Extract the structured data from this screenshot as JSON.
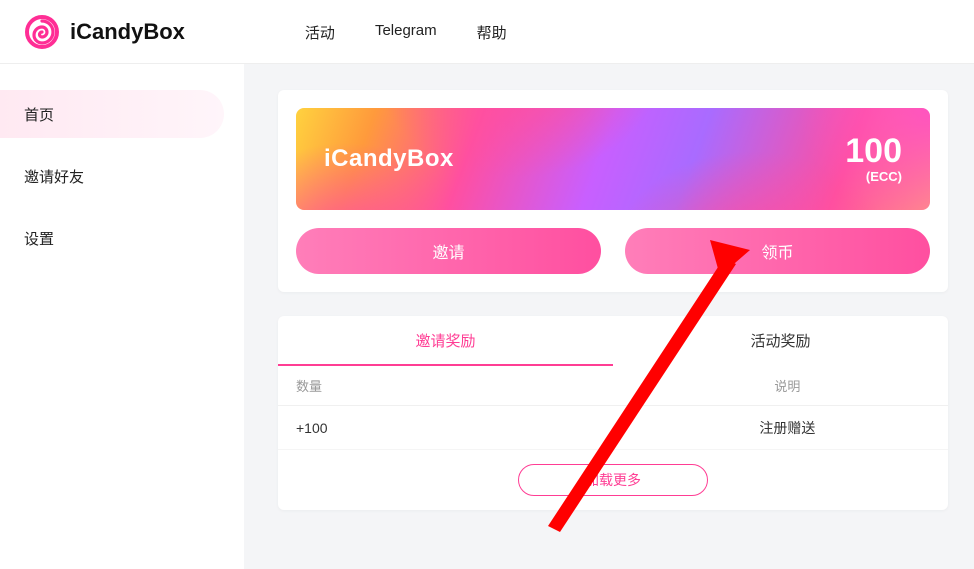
{
  "brand": "iCandyBox",
  "topnav": {
    "activity": "活动",
    "telegram": "Telegram",
    "help": "帮助"
  },
  "sidebar": {
    "home": "首页",
    "invite": "邀请好友",
    "settings": "设置"
  },
  "hero": {
    "title": "iCandyBox",
    "amount": "100",
    "unit": "(ECC)",
    "invite_btn": "邀请",
    "claim_btn": "领币"
  },
  "rewards": {
    "tab_invite": "邀请奖励",
    "tab_activity": "活动奖励",
    "col_qty": "数量",
    "col_desc": "说明",
    "rows": [
      {
        "qty": "+100",
        "desc": "注册赠送"
      }
    ],
    "load_more": "加载更多"
  }
}
